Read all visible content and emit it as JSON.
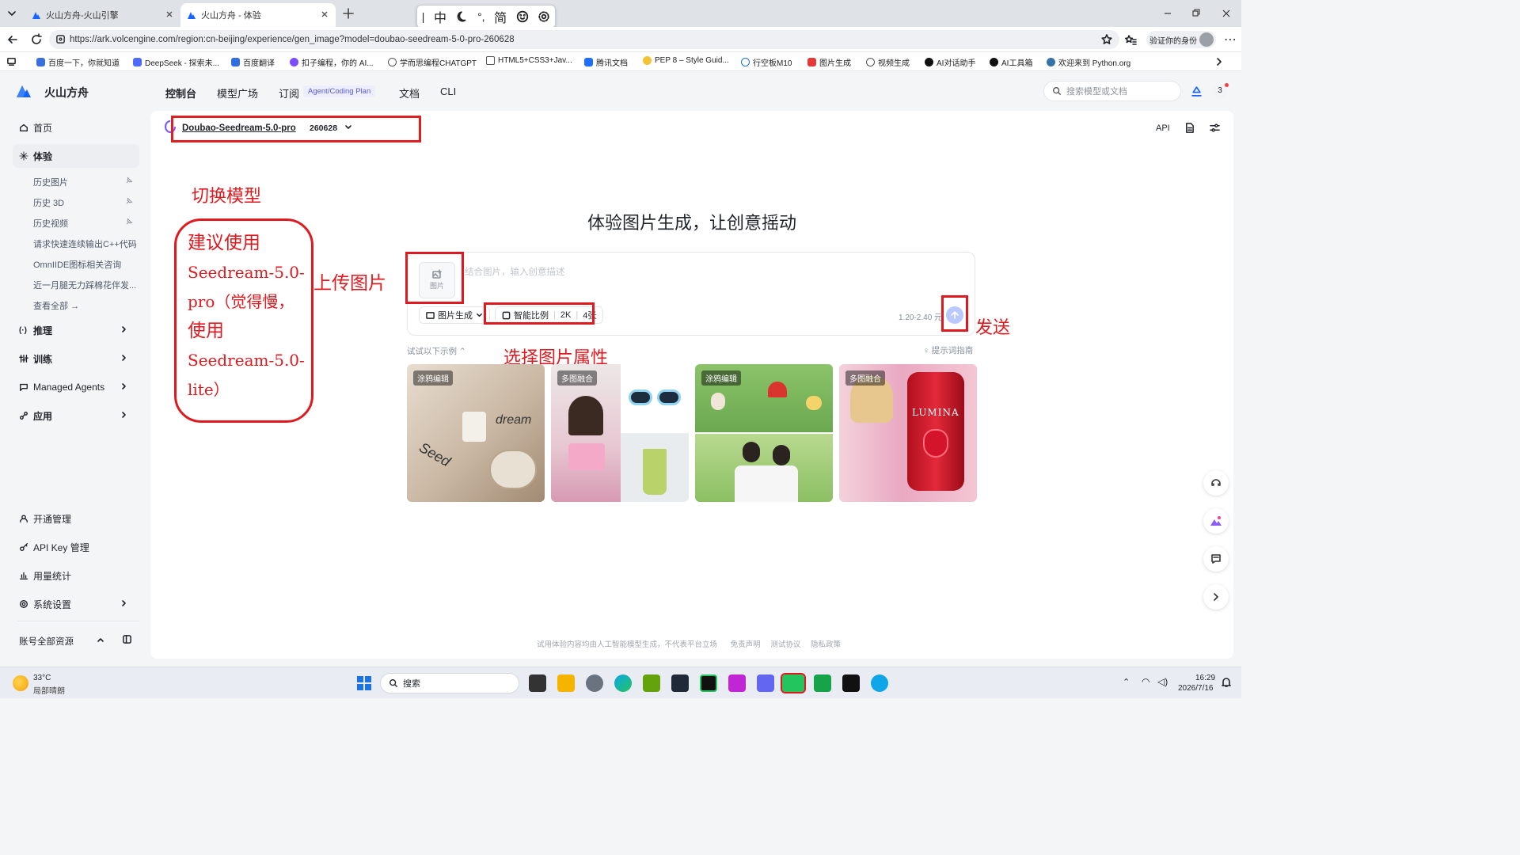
{
  "browser": {
    "tabs": [
      {
        "title": "火山方舟-火山引擎"
      },
      {
        "title": "火山方舟 - 体验"
      }
    ],
    "url": "https://ark.volcengine.com/region:cn-beijing/experience/gen_image?model=doubao-seedream-5-0-pro-260628",
    "profile_label": "验证你的身份",
    "ime": [
      "中",
      "简"
    ],
    "bookmarks": [
      "百度一下，你就知道",
      "DeepSeek - 探索未...",
      "百度翻译",
      "扣子编程，你的 AI...",
      "学而思编程CHATGPT",
      "HTML5+CSS3+Jav...",
      "腾讯文档",
      "PEP 8 – Style Guid...",
      "行空板M10",
      "图片生成",
      "视频生成",
      "AI对话助手",
      "AI工具箱",
      "欢迎来到 Python.org"
    ]
  },
  "app": {
    "brand": "火山方舟",
    "nav": [
      "控制台",
      "模型广场",
      "订阅",
      "文档",
      "CLI"
    ],
    "nav_badge": "Agent/Coding Plan",
    "search_placeholder": "搜索模型或文档",
    "notif_count": "3",
    "colors": {
      "brand": "#1664ff",
      "annotation": "#e0191e",
      "send_disabled": "#b9c8ff"
    }
  },
  "sidebar": {
    "home": "首页",
    "experience": "体验",
    "history": [
      "历史图片",
      "历史 3D",
      "历史视频",
      "请求快速连续输出C++代码",
      "OmnIIDE图标相关咨询",
      "近一月腿无力踩棉花伴发..."
    ],
    "view_all": "查看全部",
    "groups": [
      "推理",
      "训练",
      "Managed Agents",
      "应用"
    ],
    "bottom": [
      "开通管理",
      "API Key 管理",
      "用量统计",
      "系统设置"
    ],
    "account": "账号全部资源"
  },
  "main": {
    "model_name": "Doubao-Seedream-5.0-pro",
    "model_version": "260628",
    "header_right": "API",
    "hero": "体验图片生成，让创意摇动",
    "upload_label": "图片",
    "prompt_placeholder": "结合图片，输入创意描述",
    "mode": "图片生成",
    "ratio": "智能比例",
    "resolution": "2K",
    "count": "4张",
    "price": "1.20-2.40 元",
    "examples_label": "试试以下示例",
    "prompt_guide": "提示词指南",
    "examples": [
      {
        "badge": "涂鸦编辑"
      },
      {
        "badge": "多图融合"
      },
      {
        "badge": "涂鸦编辑"
      },
      {
        "badge": "多图融合"
      }
    ],
    "example_text": {
      "seed": "Seed",
      "dream": "dream",
      "can": "LUMINA"
    },
    "footer": [
      "试用体验内容均由人工智能模型生成，不代表平台立场",
      "免责声明",
      "测试协议",
      "隐私政策"
    ]
  },
  "annotations": {
    "switch_model": "切换模型",
    "suggest_lines": [
      "建议使用",
      "Seedream-5.0-",
      "pro（觉得慢，",
      "使用",
      "Seedream-5.0-",
      "lite）"
    ],
    "upload": "上传图片",
    "send": "发送",
    "props": "选择图片属性"
  },
  "taskbar": {
    "weather_temp": "33°C",
    "weather_desc": "局部晴朗",
    "search": "搜索",
    "time": "16:29",
    "date": "2026/7/16"
  }
}
